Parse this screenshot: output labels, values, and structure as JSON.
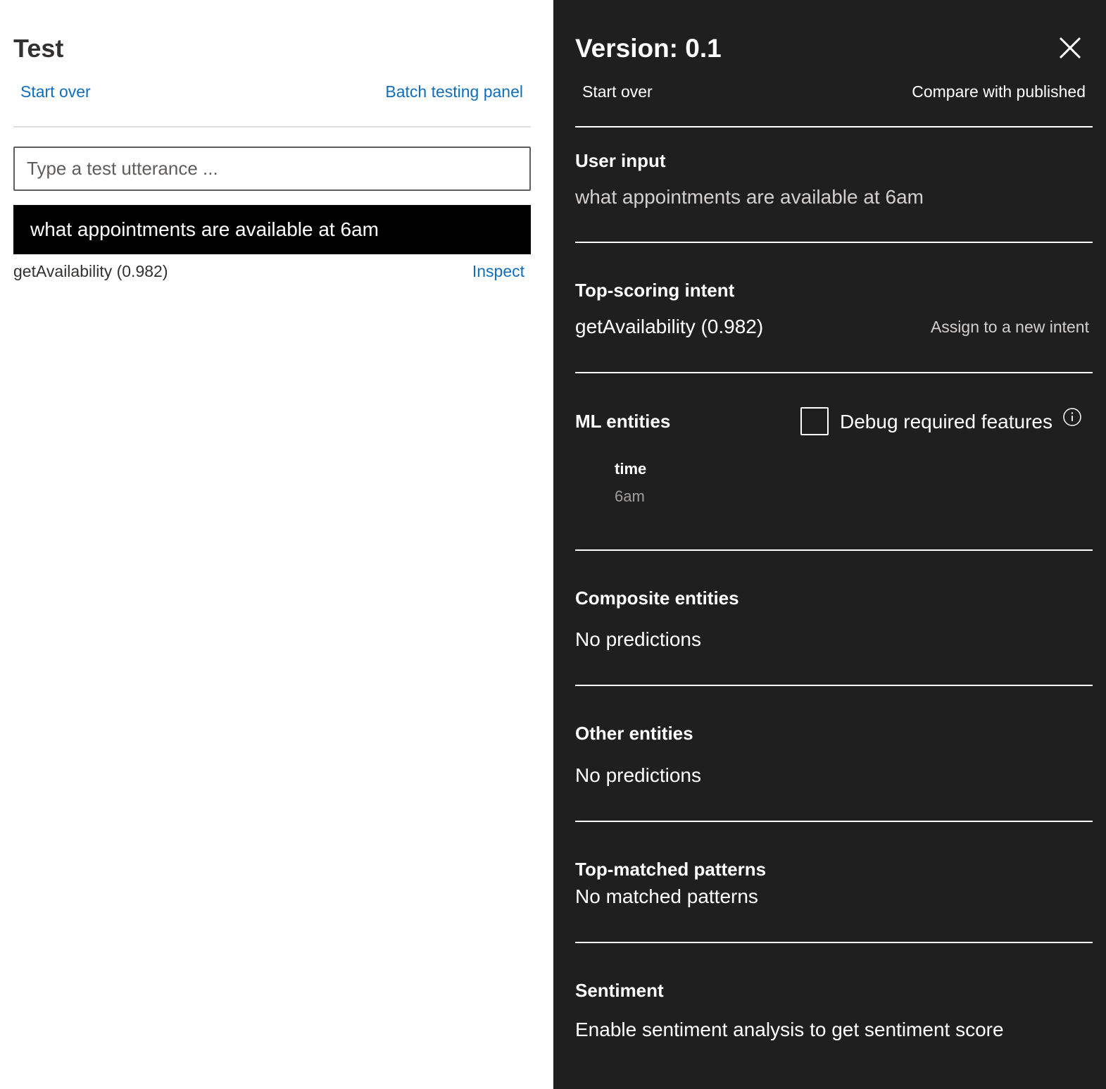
{
  "test_panel": {
    "title": "Test",
    "start_over": "Start over",
    "batch_testing": "Batch testing panel",
    "input_placeholder": "Type a test utterance ...",
    "result": {
      "utterance": "what appointments are available at 6am",
      "intent_score": "getAvailability (0.982)",
      "inspect": "Inspect"
    }
  },
  "inspect_panel": {
    "version": "Version: 0.1",
    "close_icon": "close-icon",
    "start_over": "Start over",
    "compare": "Compare with published",
    "user_input": {
      "heading": "User input",
      "value": "what appointments are available at 6am"
    },
    "top_intent": {
      "heading": "Top-scoring intent",
      "value": "getAvailability (0.982)",
      "assign": "Assign to a new intent"
    },
    "ml_entities": {
      "heading": "ML entities",
      "debug_label": "Debug required features",
      "debug_checked": false,
      "info_icon": "info-icon",
      "entities": [
        {
          "name": "time",
          "value": "6am"
        }
      ]
    },
    "composite_entities": {
      "heading": "Composite entities",
      "value": "No predictions"
    },
    "other_entities": {
      "heading": "Other entities",
      "value": "No predictions"
    },
    "patterns": {
      "heading": "Top-matched patterns",
      "value": "No matched patterns"
    },
    "sentiment": {
      "heading": "Sentiment",
      "value": "Enable sentiment analysis to get sentiment score"
    }
  },
  "colors": {
    "link": "#106ebe",
    "dark_panel": "#201f1f",
    "result_bar": "#000000"
  }
}
